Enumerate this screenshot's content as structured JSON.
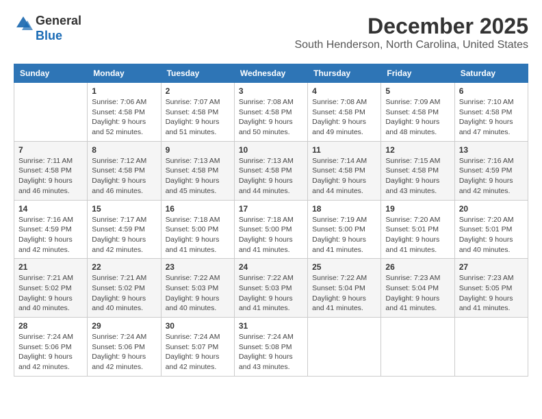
{
  "logo": {
    "line1": "General",
    "line2": "Blue",
    "icon": "▶"
  },
  "title": "December 2025",
  "location": "South Henderson, North Carolina, United States",
  "days_of_week": [
    "Sunday",
    "Monday",
    "Tuesday",
    "Wednesday",
    "Thursday",
    "Friday",
    "Saturday"
  ],
  "weeks": [
    [
      {
        "day": "",
        "info": ""
      },
      {
        "day": "1",
        "info": "Sunrise: 7:06 AM\nSunset: 4:58 PM\nDaylight: 9 hours\nand 52 minutes."
      },
      {
        "day": "2",
        "info": "Sunrise: 7:07 AM\nSunset: 4:58 PM\nDaylight: 9 hours\nand 51 minutes."
      },
      {
        "day": "3",
        "info": "Sunrise: 7:08 AM\nSunset: 4:58 PM\nDaylight: 9 hours\nand 50 minutes."
      },
      {
        "day": "4",
        "info": "Sunrise: 7:08 AM\nSunset: 4:58 PM\nDaylight: 9 hours\nand 49 minutes."
      },
      {
        "day": "5",
        "info": "Sunrise: 7:09 AM\nSunset: 4:58 PM\nDaylight: 9 hours\nand 48 minutes."
      },
      {
        "day": "6",
        "info": "Sunrise: 7:10 AM\nSunset: 4:58 PM\nDaylight: 9 hours\nand 47 minutes."
      }
    ],
    [
      {
        "day": "7",
        "info": "Sunrise: 7:11 AM\nSunset: 4:58 PM\nDaylight: 9 hours\nand 46 minutes."
      },
      {
        "day": "8",
        "info": "Sunrise: 7:12 AM\nSunset: 4:58 PM\nDaylight: 9 hours\nand 46 minutes."
      },
      {
        "day": "9",
        "info": "Sunrise: 7:13 AM\nSunset: 4:58 PM\nDaylight: 9 hours\nand 45 minutes."
      },
      {
        "day": "10",
        "info": "Sunrise: 7:13 AM\nSunset: 4:58 PM\nDaylight: 9 hours\nand 44 minutes."
      },
      {
        "day": "11",
        "info": "Sunrise: 7:14 AM\nSunset: 4:58 PM\nDaylight: 9 hours\nand 44 minutes."
      },
      {
        "day": "12",
        "info": "Sunrise: 7:15 AM\nSunset: 4:58 PM\nDaylight: 9 hours\nand 43 minutes."
      },
      {
        "day": "13",
        "info": "Sunrise: 7:16 AM\nSunset: 4:59 PM\nDaylight: 9 hours\nand 42 minutes."
      }
    ],
    [
      {
        "day": "14",
        "info": "Sunrise: 7:16 AM\nSunset: 4:59 PM\nDaylight: 9 hours\nand 42 minutes."
      },
      {
        "day": "15",
        "info": "Sunrise: 7:17 AM\nSunset: 4:59 PM\nDaylight: 9 hours\nand 42 minutes."
      },
      {
        "day": "16",
        "info": "Sunrise: 7:18 AM\nSunset: 5:00 PM\nDaylight: 9 hours\nand 41 minutes."
      },
      {
        "day": "17",
        "info": "Sunrise: 7:18 AM\nSunset: 5:00 PM\nDaylight: 9 hours\nand 41 minutes."
      },
      {
        "day": "18",
        "info": "Sunrise: 7:19 AM\nSunset: 5:00 PM\nDaylight: 9 hours\nand 41 minutes."
      },
      {
        "day": "19",
        "info": "Sunrise: 7:20 AM\nSunset: 5:01 PM\nDaylight: 9 hours\nand 41 minutes."
      },
      {
        "day": "20",
        "info": "Sunrise: 7:20 AM\nSunset: 5:01 PM\nDaylight: 9 hours\nand 40 minutes."
      }
    ],
    [
      {
        "day": "21",
        "info": "Sunrise: 7:21 AM\nSunset: 5:02 PM\nDaylight: 9 hours\nand 40 minutes."
      },
      {
        "day": "22",
        "info": "Sunrise: 7:21 AM\nSunset: 5:02 PM\nDaylight: 9 hours\nand 40 minutes."
      },
      {
        "day": "23",
        "info": "Sunrise: 7:22 AM\nSunset: 5:03 PM\nDaylight: 9 hours\nand 40 minutes."
      },
      {
        "day": "24",
        "info": "Sunrise: 7:22 AM\nSunset: 5:03 PM\nDaylight: 9 hours\nand 41 minutes."
      },
      {
        "day": "25",
        "info": "Sunrise: 7:22 AM\nSunset: 5:04 PM\nDaylight: 9 hours\nand 41 minutes."
      },
      {
        "day": "26",
        "info": "Sunrise: 7:23 AM\nSunset: 5:04 PM\nDaylight: 9 hours\nand 41 minutes."
      },
      {
        "day": "27",
        "info": "Sunrise: 7:23 AM\nSunset: 5:05 PM\nDaylight: 9 hours\nand 41 minutes."
      }
    ],
    [
      {
        "day": "28",
        "info": "Sunrise: 7:24 AM\nSunset: 5:06 PM\nDaylight: 9 hours\nand 42 minutes."
      },
      {
        "day": "29",
        "info": "Sunrise: 7:24 AM\nSunset: 5:06 PM\nDaylight: 9 hours\nand 42 minutes."
      },
      {
        "day": "30",
        "info": "Sunrise: 7:24 AM\nSunset: 5:07 PM\nDaylight: 9 hours\nand 42 minutes."
      },
      {
        "day": "31",
        "info": "Sunrise: 7:24 AM\nSunset: 5:08 PM\nDaylight: 9 hours\nand 43 minutes."
      },
      {
        "day": "",
        "info": ""
      },
      {
        "day": "",
        "info": ""
      },
      {
        "day": "",
        "info": ""
      }
    ]
  ]
}
